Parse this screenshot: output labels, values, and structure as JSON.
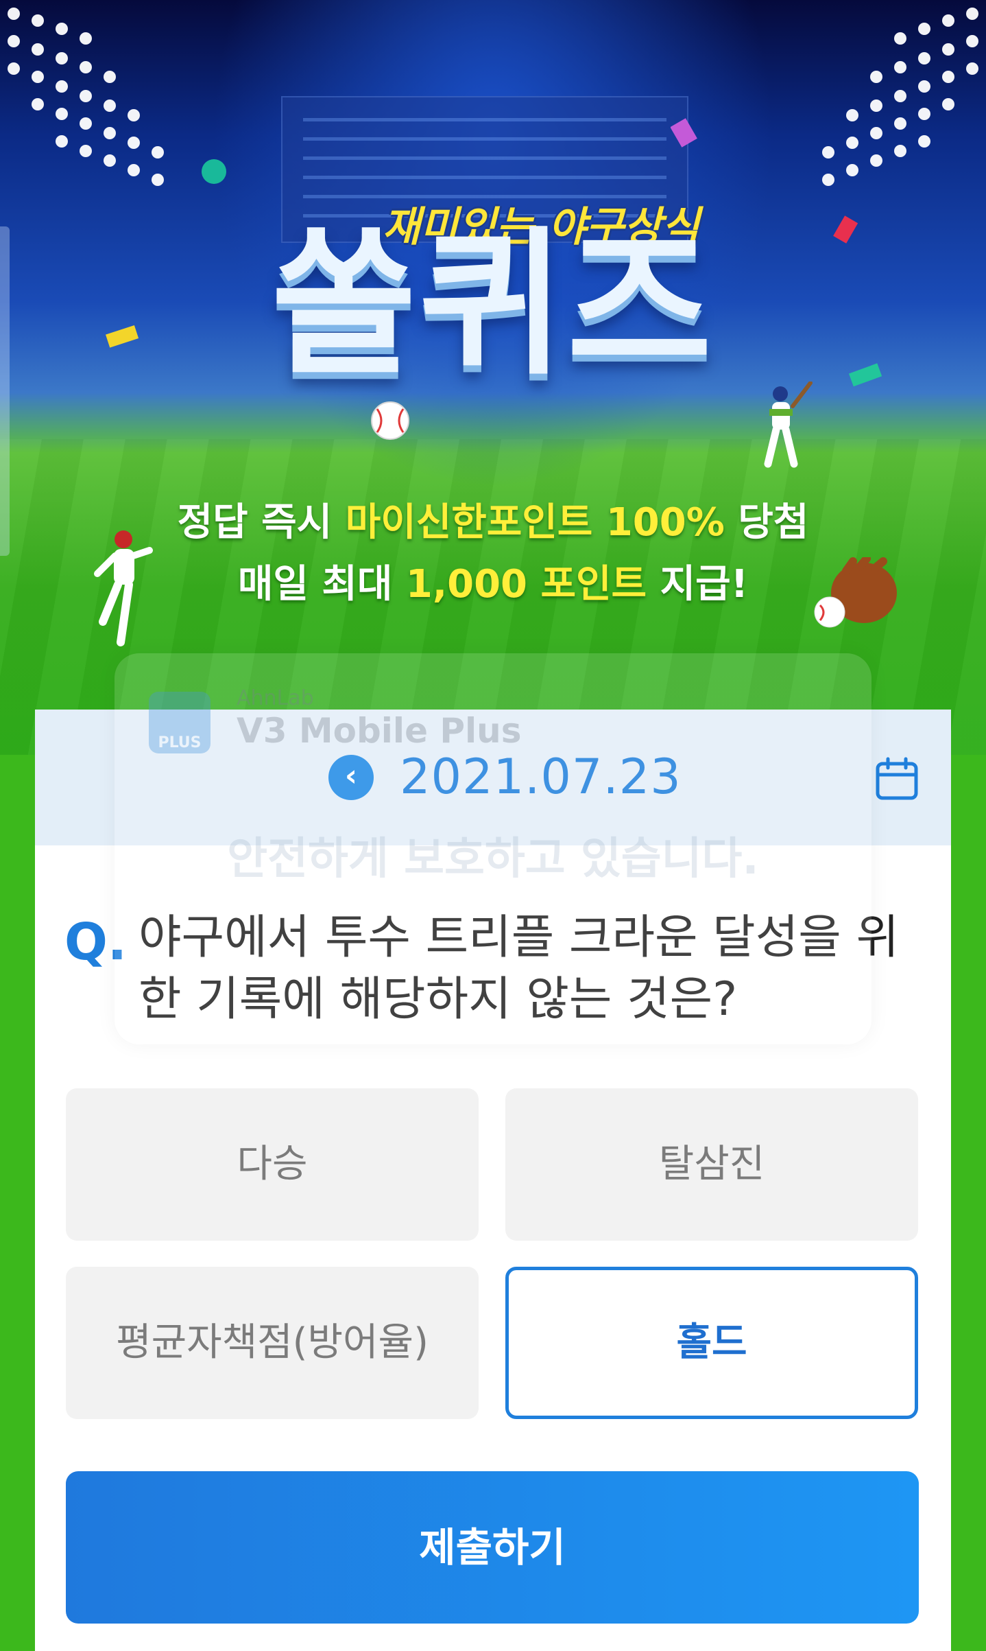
{
  "banner": {
    "subtitle": "재미있는 야구상식",
    "title": "쏠퀴즈",
    "promo_line1": {
      "prefix": "정답 즉시 ",
      "highlight": "마이신한포인트 100%",
      "suffix": " 당첨"
    },
    "promo_line2": {
      "prefix": "매일 최대 ",
      "highlight": "1,000 포인트",
      "suffix": " 지급!"
    },
    "colors": {
      "highlight": "#ffef3a",
      "sky": "#0b2a86",
      "field": "#37ad1d"
    }
  },
  "date_nav": {
    "prev_icon": "chevron-left-icon",
    "prev_glyph": "‹",
    "date": "2021.07.23",
    "calendar_icon": "calendar-icon"
  },
  "overlay": {
    "logo_text": "PLUS",
    "company": "AhnLab",
    "app": "V3 Mobile Plus",
    "message": "안전하게 보호하고 있습니다."
  },
  "quiz": {
    "q_marker": "Q.",
    "question": "야구에서 투수 트리플 크라운 달성을 위한 기록에 해당하지 않는 것은?",
    "options": [
      {
        "label": "다승",
        "selected": false
      },
      {
        "label": "탈삼진",
        "selected": false
      },
      {
        "label": "평균자책점(방어율)",
        "selected": false
      },
      {
        "label": "홀드",
        "selected": true
      }
    ],
    "submit_label": "제출하기",
    "accent_color": "#1f7fdc"
  }
}
